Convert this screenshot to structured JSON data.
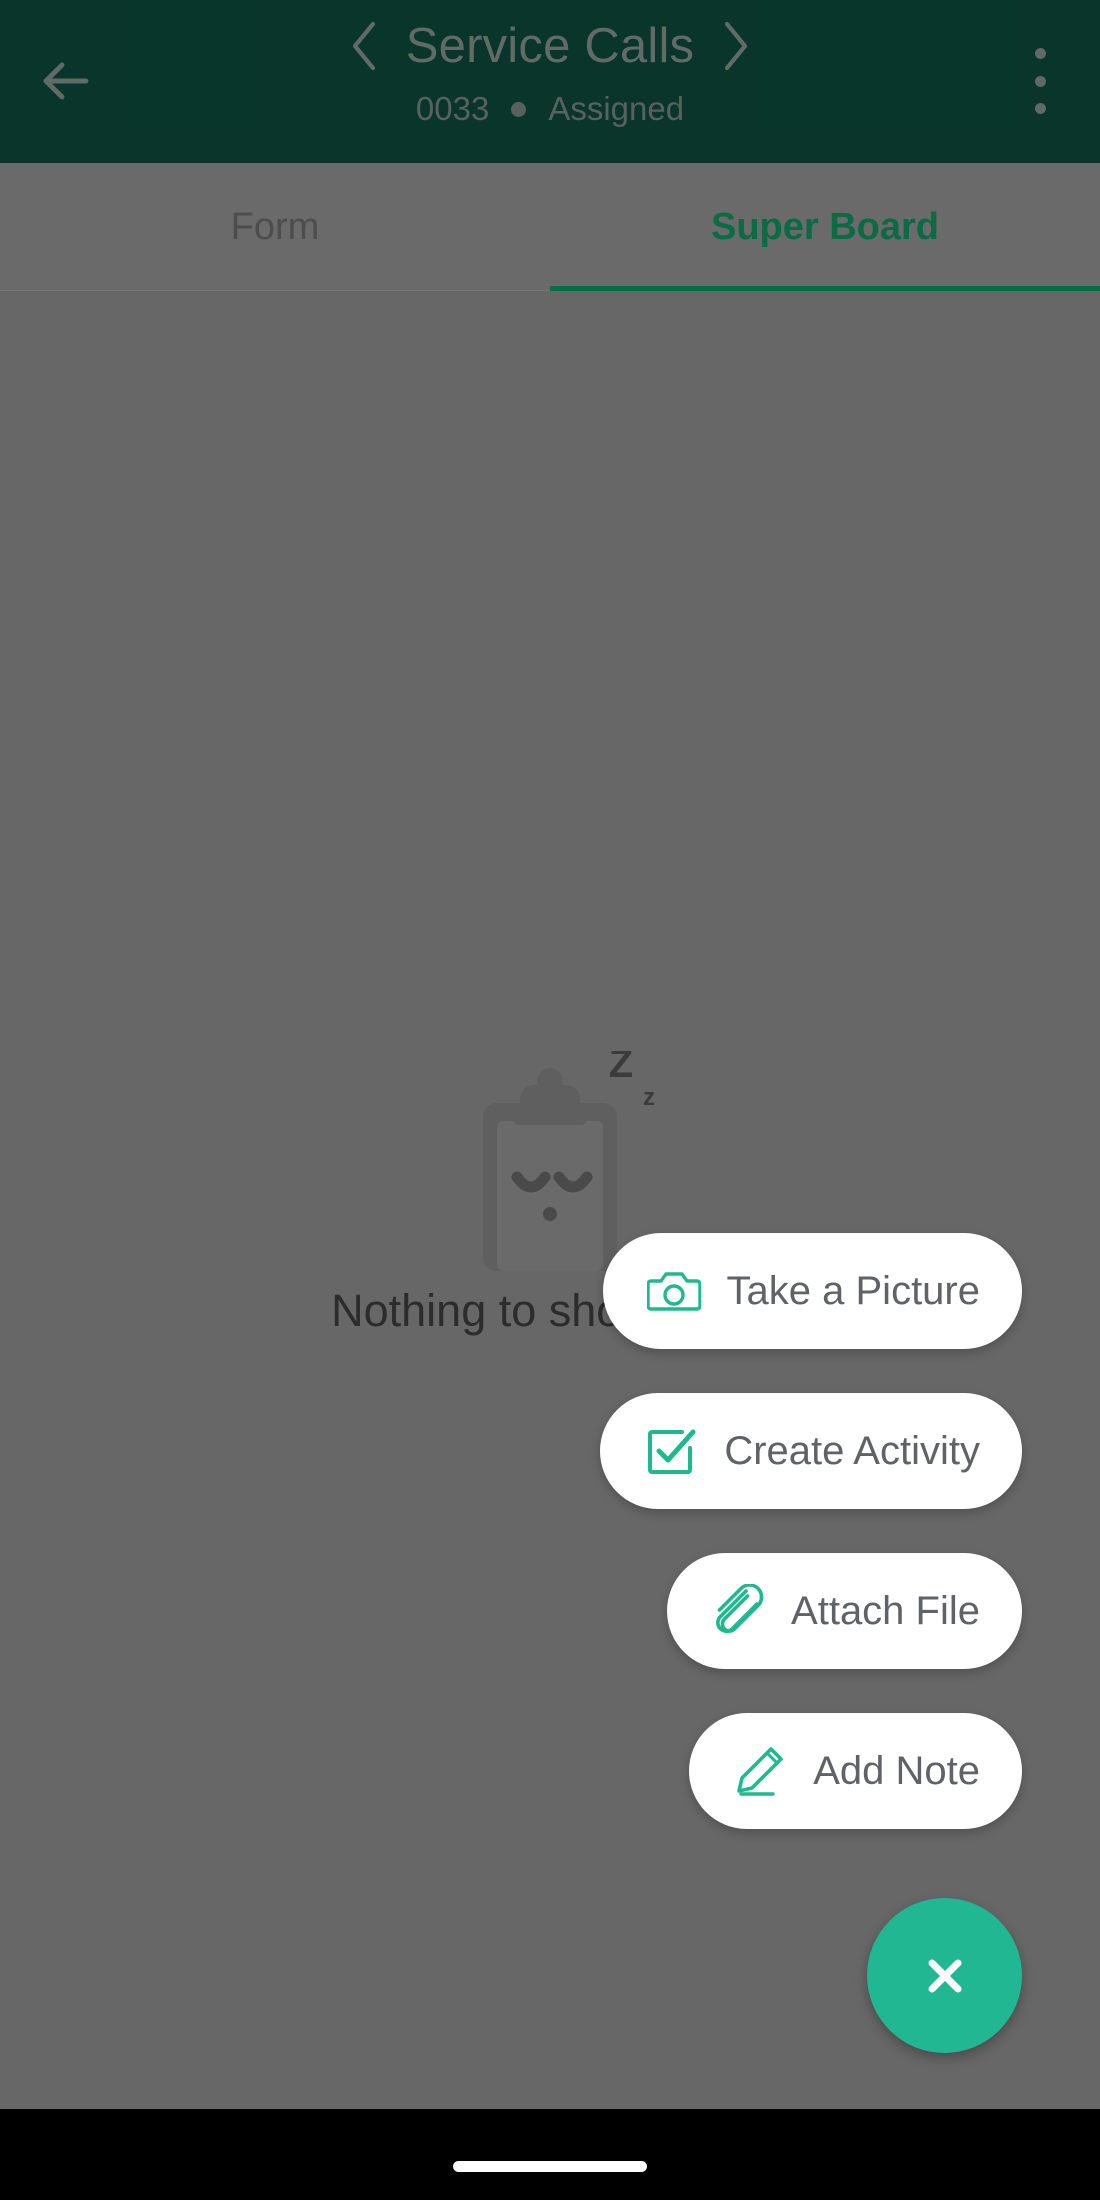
{
  "header": {
    "title": "Service Calls",
    "record_number": "0033",
    "status": "Assigned",
    "back_icon": "arrow-left-icon",
    "prev_icon": "chevron-left-icon",
    "next_icon": "chevron-right-icon",
    "overflow_icon": "more-vertical-icon",
    "background_color": "#0e4f3f",
    "text_color": "#8e9c97"
  },
  "tabs": [
    {
      "label": "Form",
      "active": false
    },
    {
      "label": "Super Board",
      "active": true
    }
  ],
  "tab_accent_color": "#0a6b45",
  "empty_state": {
    "message": "Nothing to show here.",
    "illustration": "sleeping-clipboard-icon",
    "sleep_marks": [
      "Z",
      "z"
    ]
  },
  "speed_dial": {
    "open": true,
    "accent_color": "#22b793",
    "actions": [
      {
        "label": "Take a Picture",
        "icon": "camera-icon"
      },
      {
        "label": "Create Activity",
        "icon": "check-square-icon"
      },
      {
        "label": "Attach File",
        "icon": "paperclip-icon"
      },
      {
        "label": "Add Note",
        "icon": "pencil-icon"
      }
    ],
    "close_button": {
      "icon": "close-icon",
      "label": "Close"
    }
  },
  "system_nav": {
    "gesture_bar": "home-gesture-bar"
  }
}
